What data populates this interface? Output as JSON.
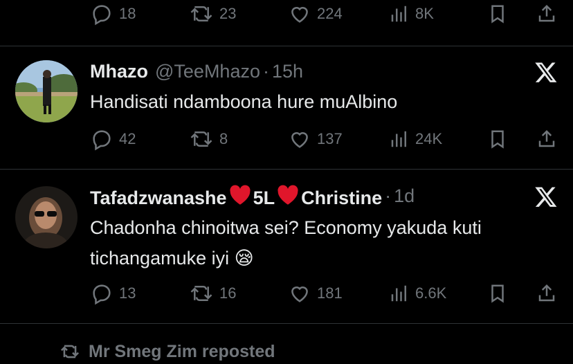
{
  "top_actions": {
    "reply_count": "18",
    "repost_count": "23",
    "like_count": "224",
    "view_count": "8K"
  },
  "tweets": [
    {
      "name": "Mhazo",
      "handle": "@TeeMhazo",
      "time": "15h",
      "text": "Handisati ndamboona hure muAlbino",
      "reply_count": "42",
      "repost_count": "8",
      "like_count": "137",
      "view_count": "24K"
    },
    {
      "name_part1": "Tafadzwanashe",
      "name_part2": "5L",
      "name_part3": "Christine",
      "time": "1d",
      "text": "Chadonha chinoitwa sei? Economy yakuda kuti tichangamuke iyi 😪",
      "reply_count": "13",
      "repost_count": "16",
      "like_count": "181",
      "view_count": "6.6K"
    }
  ],
  "repost_banner": {
    "text": "Mr Smeg Zim reposted"
  },
  "colors": {
    "background": "#000000",
    "text_primary": "#e7e9ea",
    "text_secondary": "#71767b",
    "divider": "#2f3336",
    "heart": "#e0162b"
  }
}
